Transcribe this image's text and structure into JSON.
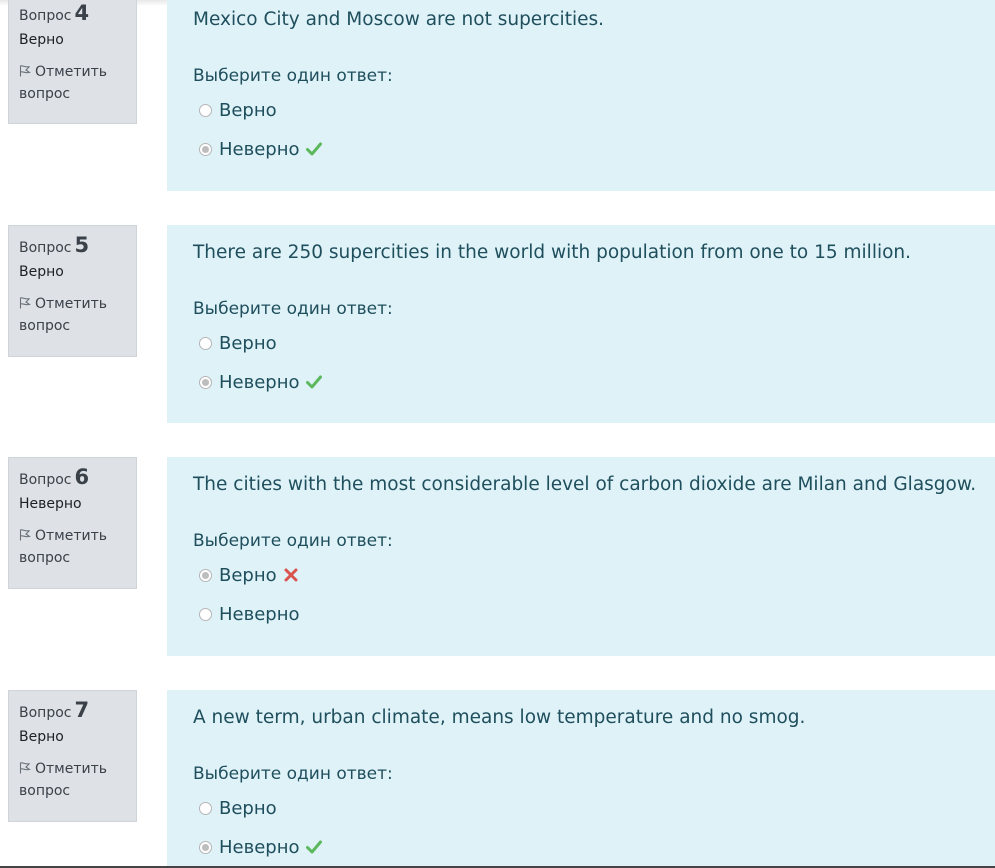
{
  "common": {
    "question_label": "Вопрос",
    "flag_line1": "Отметить",
    "flag_line2": "вопрос",
    "prompt": "Выберите один ответ:",
    "option_true": "Верно",
    "option_false": "Неверно"
  },
  "questions": [
    {
      "number": "4",
      "state": "Верно",
      "text": "Mexico City and Moscow are not supercities.",
      "selected": "Неверно",
      "result": "correct"
    },
    {
      "number": "5",
      "state": "Верно",
      "text": "There are 250 supercities in the world with population from one to 15 million.",
      "selected": "Неверно",
      "result": "correct"
    },
    {
      "number": "6",
      "state": "Неверно",
      "text": "The cities with the most considerable level of carbon dioxide are Milan and Glasgow.",
      "selected": "Верно",
      "result": "incorrect"
    },
    {
      "number": "7",
      "state": "Верно",
      "text": "A new term, urban climate, means low temperature and no smog.",
      "selected": "Неверно",
      "result": "correct"
    }
  ],
  "colors": {
    "content_bg": "#def2f8",
    "info_bg": "#dee2e6",
    "correct_mark": "#5cb85c",
    "incorrect_mark": "#d9534f"
  },
  "icons": {
    "flag": "flag-icon",
    "correct": "check-icon",
    "incorrect": "cross-icon"
  }
}
